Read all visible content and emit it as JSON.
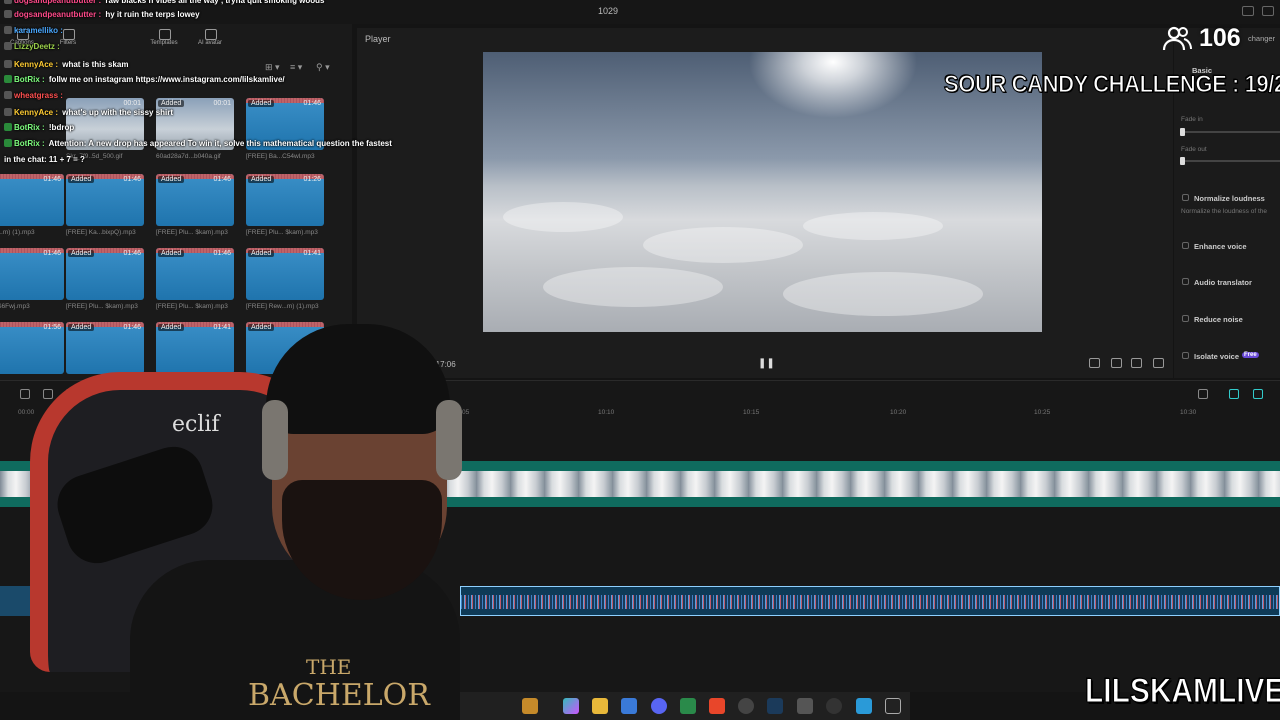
{
  "app": {
    "project_name": "1029"
  },
  "chat": [
    {
      "user": "dogsandpeanutbutter",
      "message": "raw blacks n vibes all the way , tryna quit smoking woods",
      "user_color": "#ff4a8a"
    },
    {
      "user": "dogsandpeanutbutter",
      "message": "hy it ruin the terps lowey",
      "user_color": "#ff4a8a"
    },
    {
      "user": "karamelliko",
      "message": "",
      "user_color": "#4aa8ff"
    },
    {
      "user": "LizzyDeetz",
      "message": "",
      "user_color": "#9bd14a"
    },
    {
      "user": "KennyAce",
      "message": "what is this skam",
      "user_color": "#ffcc33"
    },
    {
      "user": "BotRix",
      "message": "follw me on instagram https://www.instagram.com/lilskamlive/",
      "user_color": "#7fff7f"
    },
    {
      "user": "wheatgrass",
      "message": "",
      "user_color": "#ff5050"
    },
    {
      "user": "KennyAce",
      "message": "what's up with the sissy shirt",
      "user_color": "#ffcc33"
    },
    {
      "user": "BotRix",
      "message": "!bdrop",
      "user_color": "#7fff7f"
    },
    {
      "user": "BotRix",
      "message": "Attention: A new drop has appeared",
      "message2": "To win it, solve this mathematical question the fastest",
      "user_color": "#7fff7f"
    },
    {
      "user": "",
      "message": "in the chat: 11 + 7 = ?",
      "user_color": "#ffffff"
    }
  ],
  "media_panel": {
    "tools": [
      "Captions",
      "Filters",
      "Templates",
      "AI avatar"
    ],
    "thumbs": [
      {
        "tag": "",
        "dur": "00:01",
        "name": "Skr_7f9..5d_500.gif",
        "kind": "photo"
      },
      {
        "tag": "Added",
        "dur": "00:01",
        "name": "60ad28a7d...b040a.gif",
        "kind": "photo"
      },
      {
        "tag": "Added",
        "dur": "01:46",
        "name": "[FREE] Ba...C54wl.mp3",
        "kind": "audio"
      },
      {
        "tag": "",
        "dur": "01:46",
        "name": "Goy...m) (1).mp3",
        "kind": "audio"
      },
      {
        "tag": "Added",
        "dur": "01:46",
        "name": "[FREE] Ka...bixpQ).mp3",
        "kind": "audio"
      },
      {
        "tag": "Added",
        "dur": "01:46",
        "name": "[FREE] Plu... $kam).mp3",
        "kind": "audio"
      },
      {
        "tag": "Added",
        "dur": "01:26",
        "name": "[FREE] Plu... $kam).mp3",
        "kind": "audio"
      },
      {
        "tag": "",
        "dur": "01:46",
        "name": "Pl...S6Fwj.mp3",
        "kind": "audio"
      },
      {
        "tag": "Added",
        "dur": "01:46",
        "name": "[FREE] Plu... $kam).mp3",
        "kind": "audio"
      },
      {
        "tag": "Added",
        "dur": "01:46",
        "name": "[FREE] Plu... $kam).mp3",
        "kind": "audio"
      },
      {
        "tag": "Added",
        "dur": "01:41",
        "name": "[FREE] Rew...m) (1).mp3",
        "kind": "audio"
      },
      {
        "tag": "",
        "dur": "01:56",
        "name": "",
        "kind": "audio"
      },
      {
        "tag": "Added",
        "dur": "01:46",
        "name": "",
        "kind": "audio"
      },
      {
        "tag": "Added",
        "dur": "01:41",
        "name": "",
        "kind": "audio"
      },
      {
        "tag": "Added",
        "dur": "",
        "name": "",
        "kind": "audio"
      }
    ]
  },
  "player": {
    "title": "Player",
    "timecode": "3:17:06"
  },
  "right_panel": {
    "voice_changer": "changer",
    "basic": "Basic",
    "fade_in": "Fade in",
    "fade_out": "Fade out",
    "normalize": "Normalize loudness",
    "normalize_desc": "Normalize the loudness of the",
    "enhance": "Enhance voice",
    "translator": "Audio translator",
    "reduce": "Reduce noise",
    "isolate": "Isolate voice",
    "free_badge": "Free"
  },
  "timeline": {
    "ruler": [
      "00:00",
      "10:05",
      "10:10",
      "10:15",
      "10:20",
      "10:25",
      "10:30"
    ]
  },
  "overlay": {
    "viewers": "106",
    "challenge": "SOUR CANDY CHALLENGE : 19/250",
    "channel": "LILSKAMLIVE",
    "shirt_line1": "THE",
    "shirt_line2": "BACHELOR",
    "chair_logo": "eclif"
  }
}
